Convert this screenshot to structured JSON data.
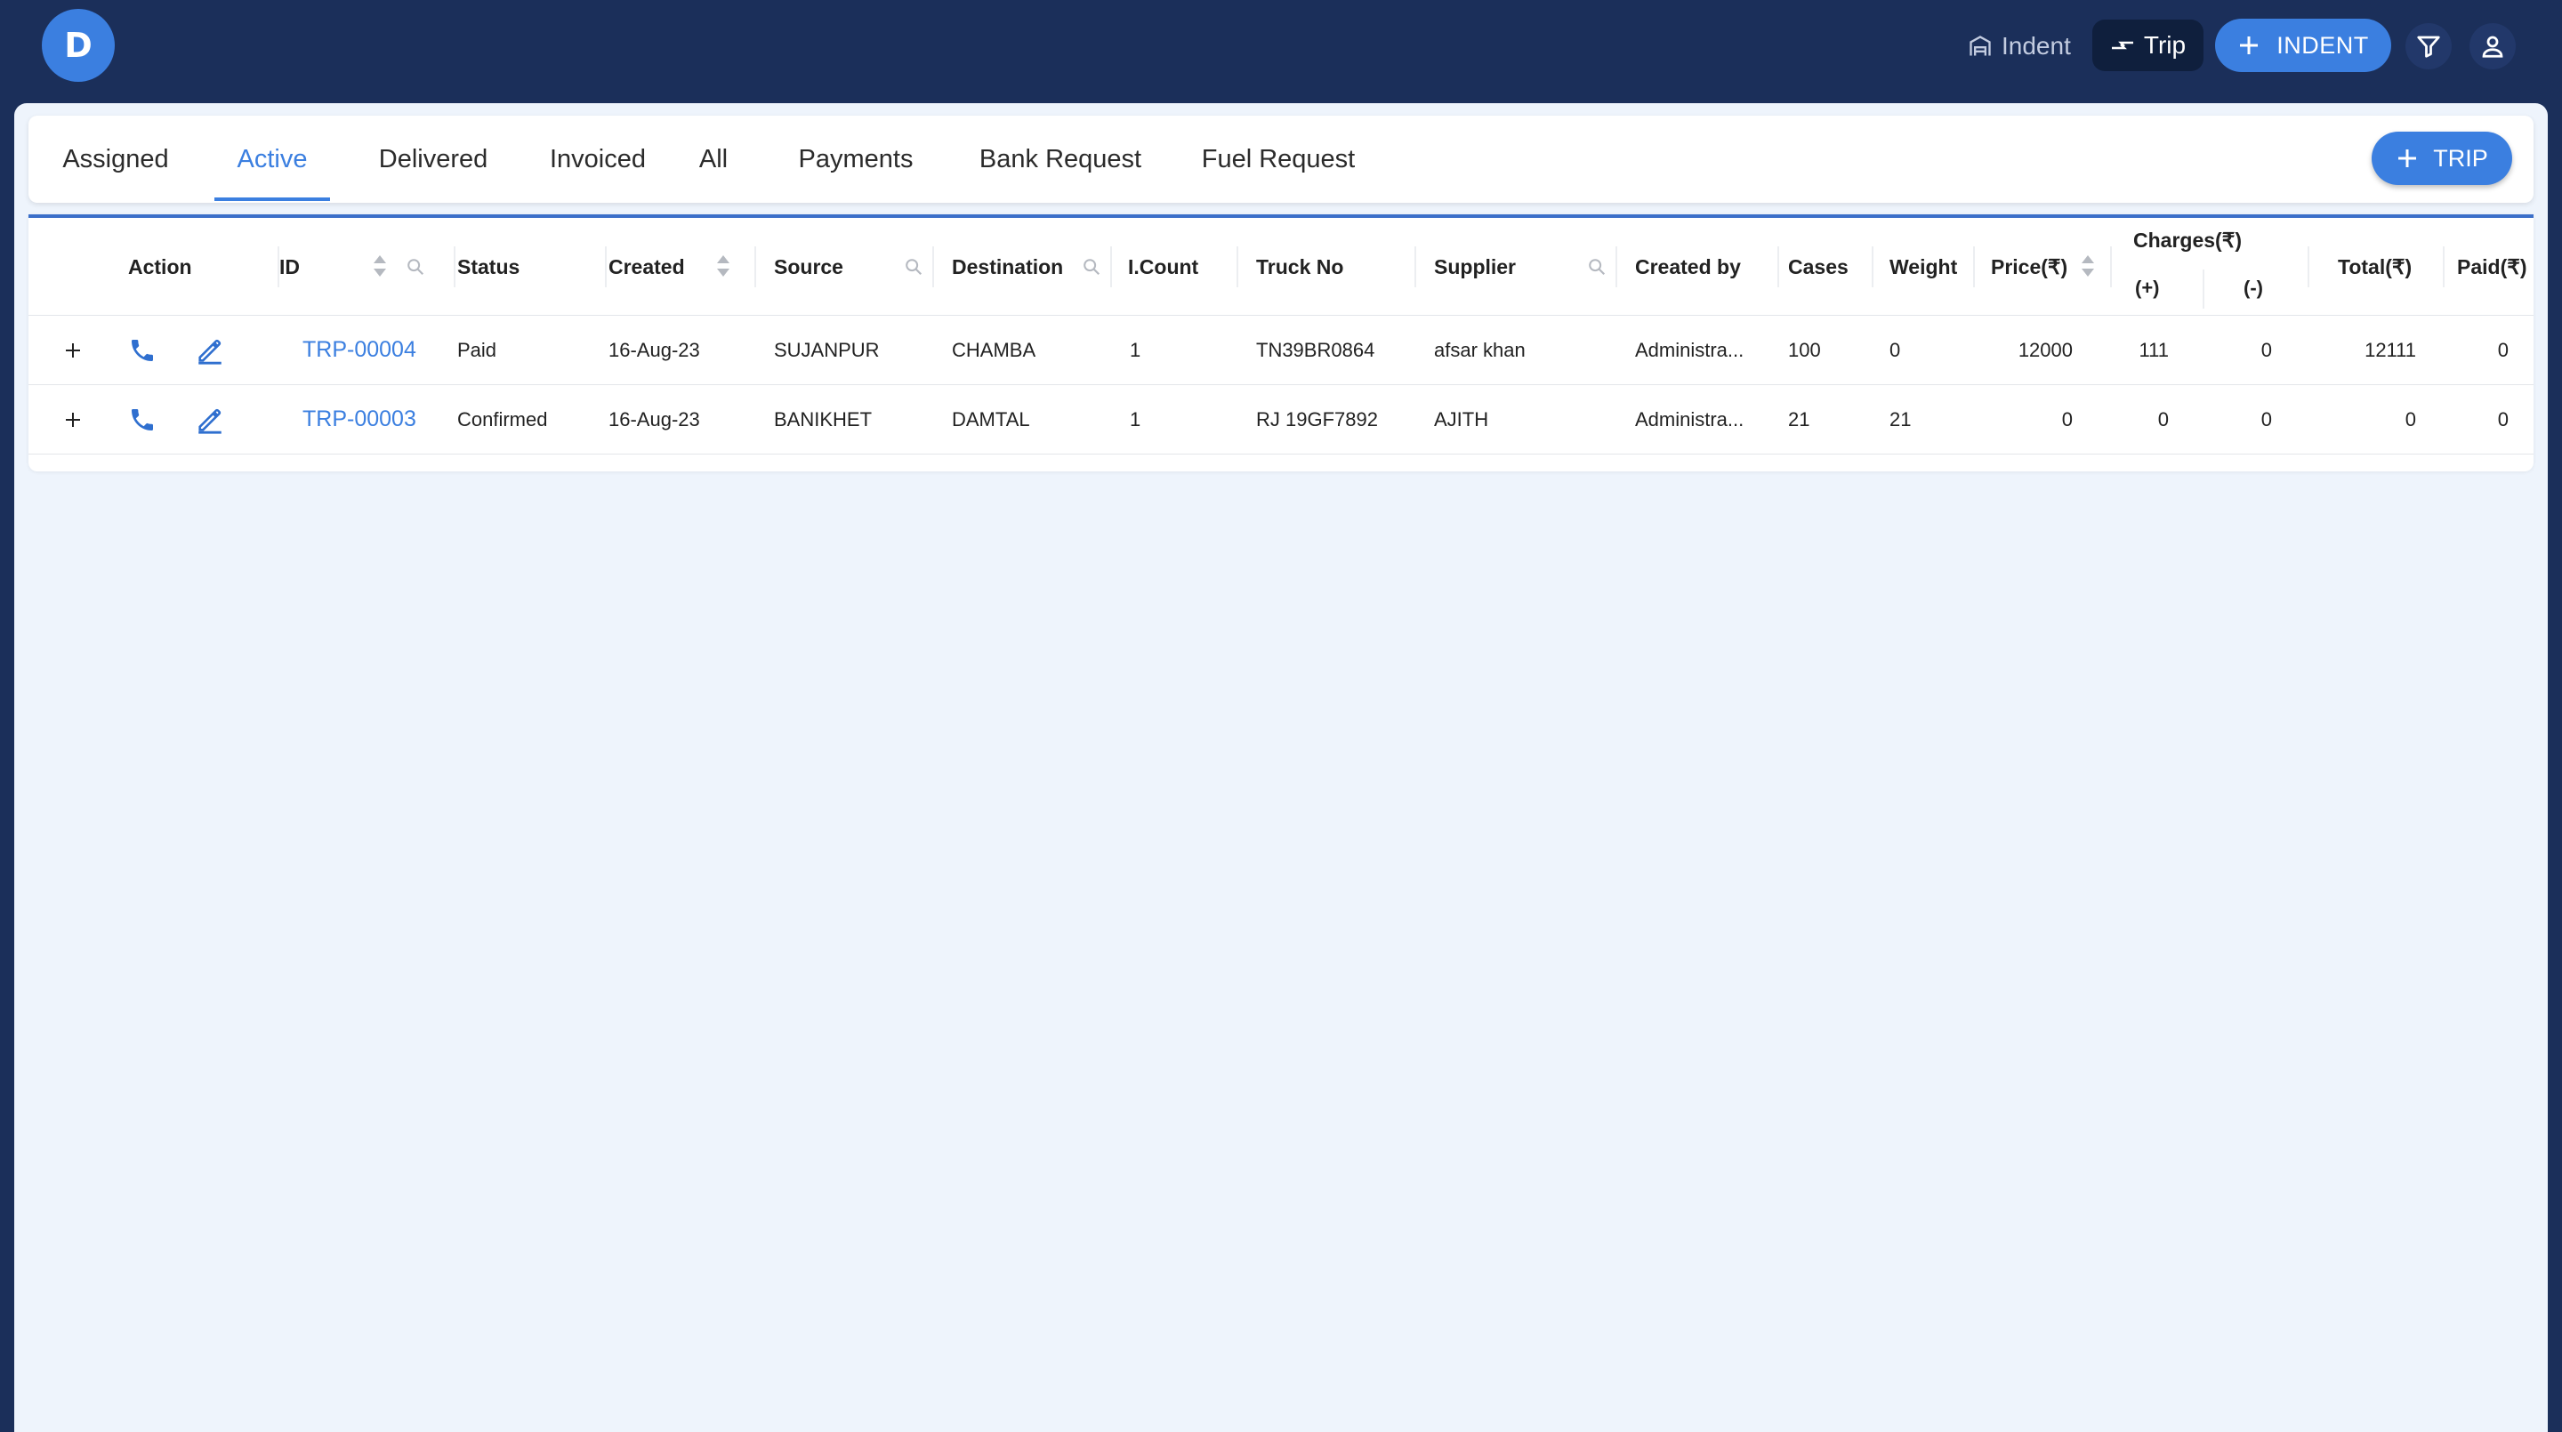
{
  "header": {
    "logo_letter": "D",
    "nav_indent_label": "Indent",
    "nav_trip_label": "Trip",
    "add_indent_label": "INDENT",
    "icons": [
      "plus-icon",
      "filter-icon",
      "user-icon",
      "building-icon",
      "swap-icon"
    ]
  },
  "tabs": [
    {
      "label": "Assigned"
    },
    {
      "label": "Active"
    },
    {
      "label": "Delivered"
    },
    {
      "label": "Invoiced"
    },
    {
      "label": "All"
    },
    {
      "label": "Payments"
    },
    {
      "label": "Bank Request"
    },
    {
      "label": "Fuel Request"
    }
  ],
  "active_tab": "Active",
  "add_trip_label": "TRIP",
  "table": {
    "columns": {
      "action": "Action",
      "id": "ID",
      "status": "Status",
      "created": "Created",
      "source": "Source",
      "destination": "Destination",
      "icount": "I.Count",
      "truck": "Truck No",
      "supplier": "Supplier",
      "created_by": "Created by",
      "cases": "Cases",
      "weight": "Weight",
      "price": "Price(₹)",
      "charges": "Charges(₹)",
      "charges_plus": "(+)",
      "charges_minus": "(-)",
      "total": "Total(₹)",
      "paid": "Paid(₹)"
    },
    "rows": [
      {
        "id": "TRP-00004",
        "status": "Paid",
        "created": "16-Aug-23",
        "source": "SUJANPUR",
        "destination": "CHAMBA",
        "icount": "1",
        "truck": "TN39BR0864",
        "supplier": "afsar khan",
        "created_by": "Administra...",
        "cases": "100",
        "weight": "0",
        "price": "12000",
        "charges_plus": "111",
        "charges_minus": "0",
        "total": "12111",
        "paid": "0"
      },
      {
        "id": "TRP-00003",
        "status": "Confirmed",
        "created": "16-Aug-23",
        "source": "BANIKHET",
        "destination": "DAMTAL",
        "icount": "1",
        "truck": "RJ 19GF7892",
        "supplier": "AJITH",
        "created_by": "Administra...",
        "cases": "21",
        "weight": "21",
        "price": "0",
        "charges_plus": "0",
        "charges_minus": "0",
        "total": "0",
        "paid": "0"
      }
    ]
  },
  "colors": {
    "header_bg": "#1b2f5a",
    "accent": "#3b7fe0",
    "panel_bg": "#eef4fc"
  }
}
